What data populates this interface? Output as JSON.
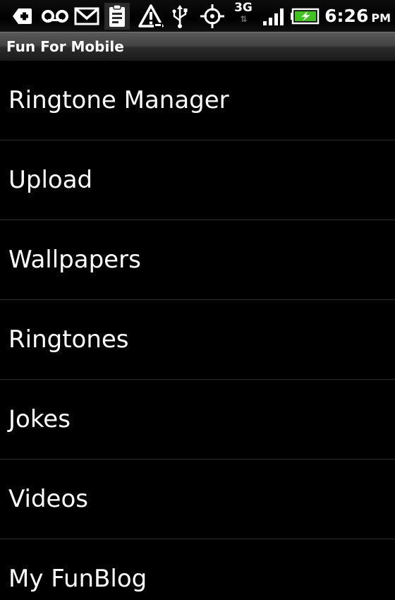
{
  "status_bar": {
    "icons": [
      "plus-badge-icon",
      "voicemail-icon",
      "gmail-icon",
      "clipboard-icon",
      "warning-icon",
      "usb-icon",
      "gps-icon",
      "signal-icon",
      "battery-charging-icon"
    ],
    "network": "3G",
    "time": "6:26",
    "ampm": "PM"
  },
  "app": {
    "title": "Fun For Mobile"
  },
  "menu": {
    "items": [
      {
        "label": "Ringtone Manager"
      },
      {
        "label": "Upload"
      },
      {
        "label": "Wallpapers"
      },
      {
        "label": "Ringtones"
      },
      {
        "label": "Jokes"
      },
      {
        "label": "Videos"
      },
      {
        "label": "My FunBlog"
      }
    ]
  },
  "colors": {
    "background": "#000000",
    "text": "#ffffff",
    "battery": "#3fc41f",
    "divider": "#2e2e2e"
  }
}
